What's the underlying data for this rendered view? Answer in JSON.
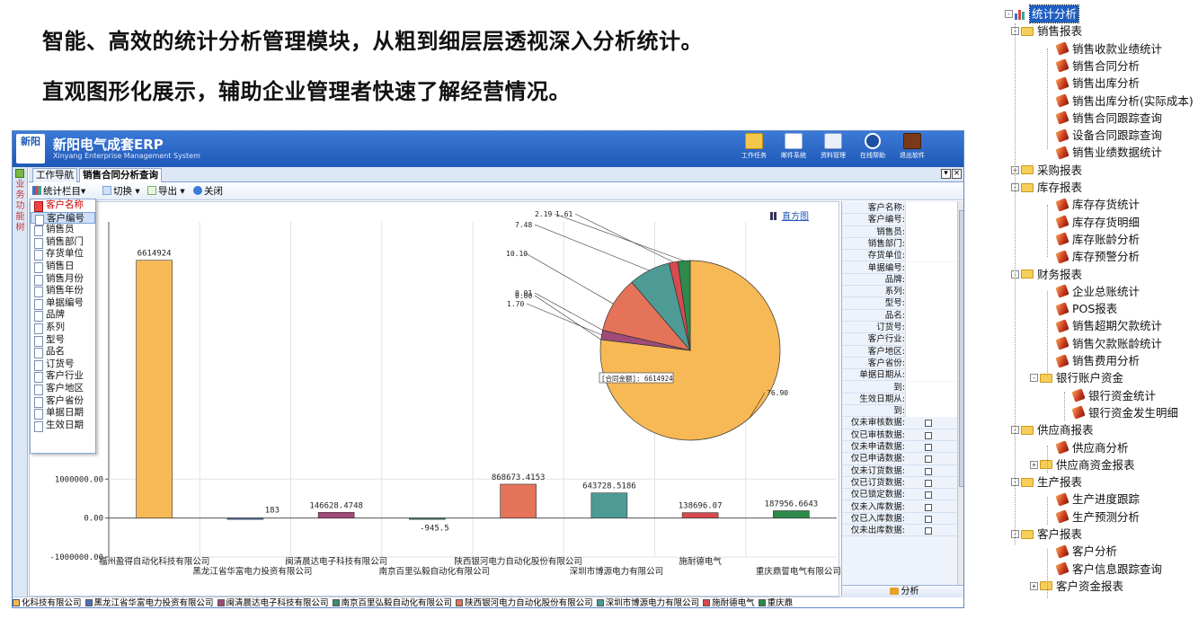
{
  "headline": {
    "line1": "智能、高效的统计分析管理模块，从粗到细层层透视深入分析统计。",
    "line2": "直观图形化展示，辅助企业管理者快速了解经营情况。"
  },
  "erp": {
    "title": "新阳电气成套ERP",
    "subtitle": "Xinyang Enterprise Management System",
    "logo_line1": "新阳",
    "logo_line2": "",
    "toolbar_buttons": [
      "工作任务",
      "邮件系统",
      "资料管理",
      "在线帮助",
      "退出软件"
    ],
    "side_label": "业务功能树",
    "tabs": [
      "工作导航",
      "销售合同分析查询"
    ],
    "tools": {
      "stat_column": "统计栏目",
      "switch": "切换",
      "export": "导出",
      "close": "关闭"
    },
    "histogram_link": "直方图",
    "dropdown_items": [
      "客户名称",
      "客户编号",
      "销售员",
      "销售部门",
      "存货单位",
      "销售日",
      "销售月份",
      "销售年份",
      "单据编号",
      "品牌",
      "系列",
      "型号",
      "品名",
      "订货号",
      "客户行业",
      "客户地区",
      "客户省份",
      "单据日期",
      "生效日期"
    ],
    "panel_fields": [
      "客户名称:",
      "客户编号:",
      "销售员:",
      "销售部门:",
      "存货单位:",
      "单据编号:",
      "品牌:",
      "系列:",
      "型号:",
      "品名:",
      "订货号:",
      "客户行业:",
      "客户地区:",
      "客户省份:",
      "单据日期从:",
      "到:",
      "生效日期从:",
      "到:"
    ],
    "panel_checks": [
      "仅未审核数据:",
      "仅已审核数据:",
      "仅未申请数据:",
      "仅已申请数据:",
      "仅未订货数据:",
      "仅已订货数据:",
      "仅已锁定数据:",
      "仅未入库数据:",
      "仅已入库数据:",
      "仅未出库数据:"
    ],
    "analyze_button": "分析",
    "legend": [
      {
        "name": "化科技有限公司",
        "color": "#f7b955"
      },
      {
        "name": "黑龙江省华富电力投资有限公司",
        "color": "#4a72b8"
      },
      {
        "name": "闽清晨达电子科技有限公司",
        "color": "#a04a7a"
      },
      {
        "name": "南京百里弘毅自动化有限公司",
        "color": "#3f8a6a"
      },
      {
        "name": "陕西银河电力自动化股份有限公司",
        "color": "#e5735a"
      },
      {
        "name": "深圳市博源电力有限公司",
        "color": "#4e9a95"
      },
      {
        "name": "施耐德电气",
        "color": "#d64a50"
      },
      {
        "name": "重庆鼎",
        "color": "#2e8a4a"
      }
    ]
  },
  "chart_data": {
    "type": "bar",
    "categories": [
      "福州盈得自动化科技有限公司",
      "黑龙江省华富电力投资有限公司",
      "闽清晨达电子科技有限公司",
      "南京百里弘毅自动化有限公司",
      "陕西银河电力自动化股份有限公司",
      "深圳市博源电力有限公司",
      "施耐德电气",
      "重庆鼎誓电气有限公司"
    ],
    "values": [
      6614924,
      183,
      146628.4748,
      -945.5,
      868673.4153,
      643728.5186,
      138696.07,
      187956.6643
    ],
    "value_labels": [
      "6614924",
      "183",
      "146628.4748",
      "-945.5",
      "868673.4153",
      "643728.5186",
      "138696.07",
      "187956.6643"
    ],
    "colors": [
      "#f7b955",
      "#4a72b8",
      "#a04a7a",
      "#3f8a6a",
      "#e5735a",
      "#4e9a95",
      "#d64a50",
      "#2e8a4a"
    ],
    "y_ticks": [
      "1000000.00",
      "0.00",
      "-1000000.00"
    ],
    "ylim": [
      -1000000,
      7600000
    ],
    "pie": {
      "label": "[合同金额]: 6614924",
      "slices": [
        {
          "pct": 76.9,
          "label": "76.90",
          "color": "#f7b955"
        },
        {
          "pct": 0.0,
          "label": "0.00",
          "color": "#4a72b8"
        },
        {
          "pct": 1.7,
          "label": "1.70",
          "color": "#a04a7a"
        },
        {
          "pct": 0.01,
          "label": "0.01",
          "color": "#3f8a6a"
        },
        {
          "pct": 10.1,
          "label": "10.10",
          "color": "#e5735a"
        },
        {
          "pct": 7.48,
          "label": "7.48",
          "color": "#4e9a95"
        },
        {
          "pct": 1.61,
          "label": "1.61",
          "color": "#d64a50"
        },
        {
          "pct": 2.19,
          "label": "2.19",
          "color": "#2e8a4a"
        }
      ]
    }
  },
  "tree": [
    {
      "label": "统计分析",
      "depth": 0,
      "kind": "root",
      "exp": "-"
    },
    {
      "label": "销售报表",
      "depth": 1,
      "kind": "folder",
      "exp": "-"
    },
    {
      "label": "销售收款业绩统计",
      "depth": 2,
      "kind": "leaf"
    },
    {
      "label": "销售合同分析",
      "depth": 2,
      "kind": "leaf"
    },
    {
      "label": "销售出库分析",
      "depth": 2,
      "kind": "leaf"
    },
    {
      "label": "销售出库分析(实际成本)",
      "depth": 2,
      "kind": "leaf"
    },
    {
      "label": "销售合同跟踪查询",
      "depth": 2,
      "kind": "leaf"
    },
    {
      "label": "设备合同跟踪查询",
      "depth": 2,
      "kind": "leaf"
    },
    {
      "label": "销售业绩数据统计",
      "depth": 2,
      "kind": "leaf"
    },
    {
      "label": "采购报表",
      "depth": 1,
      "kind": "folder",
      "exp": "+"
    },
    {
      "label": "库存报表",
      "depth": 1,
      "kind": "folder",
      "exp": "-"
    },
    {
      "label": "库存存货统计",
      "depth": 2,
      "kind": "leaf"
    },
    {
      "label": "库存存货明细",
      "depth": 2,
      "kind": "leaf"
    },
    {
      "label": "库存账龄分析",
      "depth": 2,
      "kind": "leaf"
    },
    {
      "label": "库存预警分析",
      "depth": 2,
      "kind": "leaf"
    },
    {
      "label": "财务报表",
      "depth": 1,
      "kind": "folder",
      "exp": "-"
    },
    {
      "label": "企业总账统计",
      "depth": 2,
      "kind": "leaf"
    },
    {
      "label": "POS报表",
      "depth": 2,
      "kind": "leaf"
    },
    {
      "label": "销售超期欠款统计",
      "depth": 2,
      "kind": "leaf"
    },
    {
      "label": "销售欠款账龄统计",
      "depth": 2,
      "kind": "leaf"
    },
    {
      "label": "销售费用分析",
      "depth": 2,
      "kind": "leaf"
    },
    {
      "label": "银行账户资金",
      "depth": 2,
      "kind": "folder",
      "exp": "-"
    },
    {
      "label": "银行资金统计",
      "depth": 3,
      "kind": "leaf"
    },
    {
      "label": "银行资金发生明细",
      "depth": 3,
      "kind": "leaf"
    },
    {
      "label": "供应商报表",
      "depth": 1,
      "kind": "folder",
      "exp": "-"
    },
    {
      "label": "供应商分析",
      "depth": 2,
      "kind": "leaf"
    },
    {
      "label": "供应商资金报表",
      "depth": 2,
      "kind": "folder",
      "exp": "+"
    },
    {
      "label": "生产报表",
      "depth": 1,
      "kind": "folder",
      "exp": "-"
    },
    {
      "label": "生产进度跟踪",
      "depth": 2,
      "kind": "leaf"
    },
    {
      "label": "生产预测分析",
      "depth": 2,
      "kind": "leaf"
    },
    {
      "label": "客户报表",
      "depth": 1,
      "kind": "folder",
      "exp": "-"
    },
    {
      "label": "客户分析",
      "depth": 2,
      "kind": "leaf"
    },
    {
      "label": "客户信息跟踪查询",
      "depth": 2,
      "kind": "leaf"
    },
    {
      "label": "客户资金报表",
      "depth": 2,
      "kind": "folder",
      "exp": "+"
    }
  ]
}
